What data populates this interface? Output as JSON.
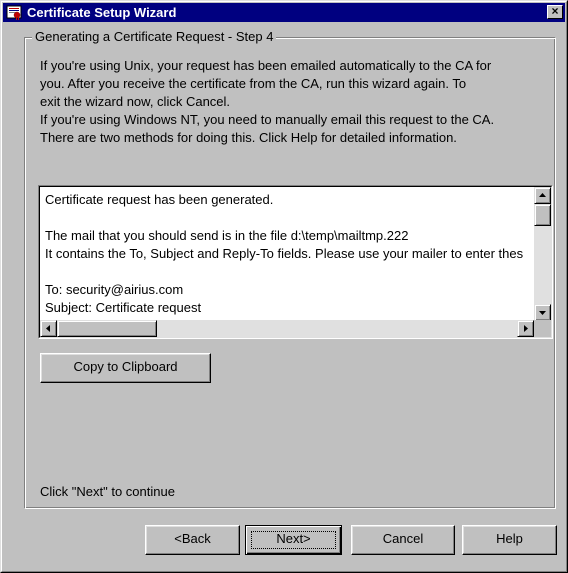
{
  "window": {
    "title": "Certificate Setup Wizard",
    "close_label": "×"
  },
  "group": {
    "legend": "Generating a Certificate Request - Step 4"
  },
  "intro_lines": [
    "If you're using Unix, your request has been emailed  automatically to the CA for",
    "you.  After you receive the certificate from the CA, run this wizard again.  To",
    "exit the wizard now, click Cancel.",
    "If you're using Windows NT, you need to manually email this request to the CA.",
    "There are two methods for doing this.  Click Help for detailed information."
  ],
  "textarea_lines": [
    "Certificate request has been generated.",
    "",
    "The mail that you should send is in the file d:\\temp\\mailtmp.222",
    "It contains the To, Subject and Reply-To fields.  Please use your mailer to enter these fields.",
    "",
    "To: security@airius.com",
    "Subject: Certificate request"
  ],
  "copy_button": "Copy to Clipboard",
  "status_text": "Click \"Next\" to continue",
  "buttons": {
    "back": "<Back",
    "next": "Next>",
    "cancel": "Cancel",
    "help": "Help"
  },
  "colors": {
    "titlebar": "#000080",
    "face": "#c0c0c0"
  }
}
